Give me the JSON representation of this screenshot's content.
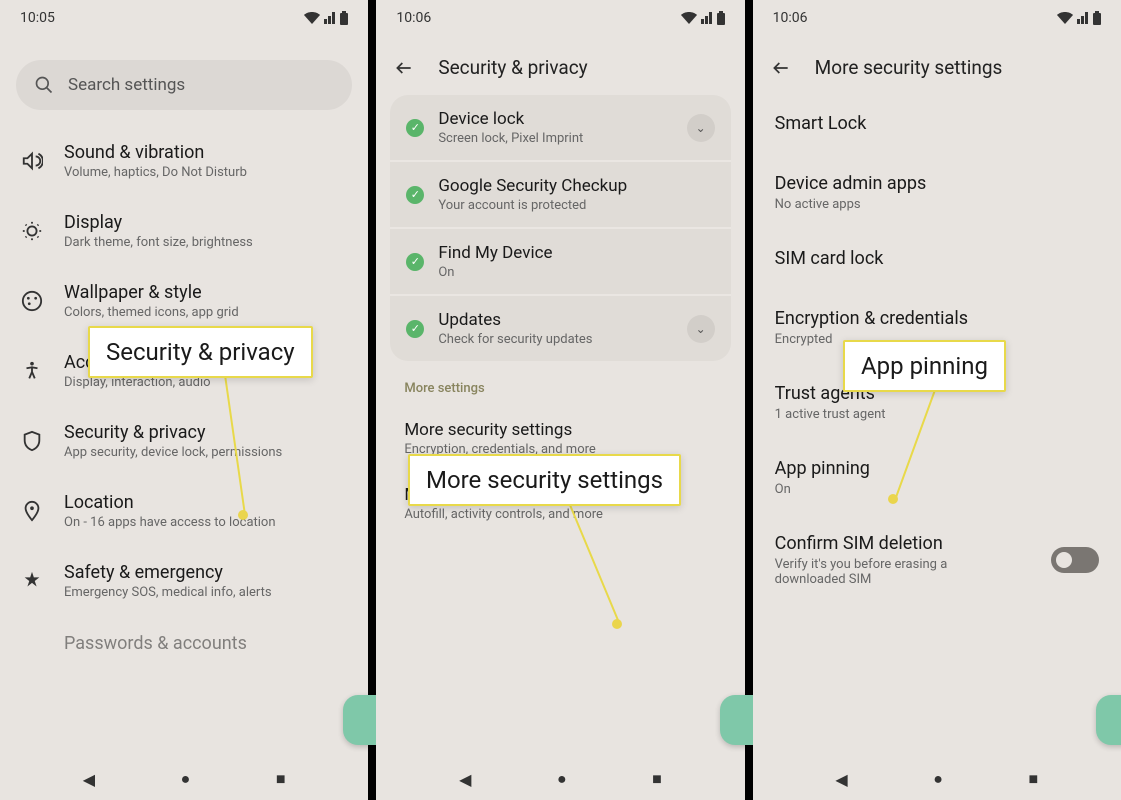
{
  "phone1": {
    "time": "10:05",
    "search_placeholder": "Search settings",
    "items": [
      {
        "title": "Sound & vibration",
        "subtitle": "Volume, haptics, Do Not Disturb"
      },
      {
        "title": "Display",
        "subtitle": "Dark theme, font size, brightness"
      },
      {
        "title": "Wallpaper & style",
        "subtitle": "Colors, themed icons, app grid"
      },
      {
        "title": "Accessibility",
        "subtitle": "Display, interaction, audio"
      },
      {
        "title": "Security & privacy",
        "subtitle": "App security, device lock, permissions"
      },
      {
        "title": "Location",
        "subtitle": "On - 16 apps have access to location"
      },
      {
        "title": "Safety & emergency",
        "subtitle": "Emergency SOS, medical info, alerts"
      },
      {
        "title": "Passwords & accounts",
        "subtitle": ""
      }
    ]
  },
  "phone2": {
    "time": "10:06",
    "header": "Security & privacy",
    "cards": [
      {
        "title": "Device lock",
        "subtitle": "Screen lock, Pixel Imprint",
        "expandable": true
      },
      {
        "title": "Google Security Checkup",
        "subtitle": "Your account is protected",
        "expandable": false
      },
      {
        "title": "Find My Device",
        "subtitle": "On",
        "expandable": false
      },
      {
        "title": "Updates",
        "subtitle": "Check for security updates",
        "expandable": true
      }
    ],
    "more_label": "More settings",
    "more_items": [
      {
        "title": "More security settings",
        "subtitle": "Encryption, credentials, and more"
      },
      {
        "title": "More privacy settings",
        "subtitle": "Autofill, activity controls, and more"
      }
    ]
  },
  "phone3": {
    "time": "10:06",
    "header": "More security settings",
    "items": [
      {
        "title": "Smart Lock",
        "subtitle": ""
      },
      {
        "title": "Device admin apps",
        "subtitle": "No active apps"
      },
      {
        "title": "SIM card lock",
        "subtitle": ""
      },
      {
        "title": "Encryption & credentials",
        "subtitle": "Encrypted"
      },
      {
        "title": "Trust agents",
        "subtitle": "1 active trust agent"
      },
      {
        "title": "App pinning",
        "subtitle": "On"
      },
      {
        "title": "Confirm SIM deletion",
        "subtitle": "Verify it's you before erasing a downloaded SIM",
        "toggle": true
      }
    ]
  },
  "callouts": {
    "security_privacy": "Security & privacy",
    "more_security": "More security settings",
    "app_pinning": "App pinning"
  }
}
